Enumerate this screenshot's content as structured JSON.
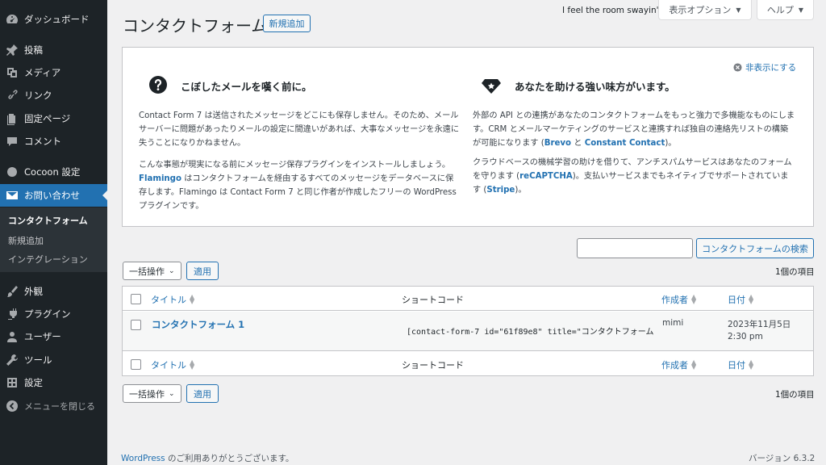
{
  "sidebar": {
    "items": [
      {
        "label": "ダッシュボード",
        "icon": "dashboard-icon"
      },
      {
        "label": "投稿",
        "icon": "pin-icon"
      },
      {
        "label": "メディア",
        "icon": "media-icon"
      },
      {
        "label": "リンク",
        "icon": "link-icon"
      },
      {
        "label": "固定ページ",
        "icon": "page-icon"
      },
      {
        "label": "コメント",
        "icon": "comment-icon"
      },
      {
        "label": "Cocoon 設定",
        "icon": "circle-icon"
      },
      {
        "label": "お問い合わせ",
        "icon": "mail-icon"
      },
      {
        "label": "外観",
        "icon": "brush-icon"
      },
      {
        "label": "プラグイン",
        "icon": "plugin-icon"
      },
      {
        "label": "ユーザー",
        "icon": "user-icon"
      },
      {
        "label": "ツール",
        "icon": "wrench-icon"
      },
      {
        "label": "設定",
        "icon": "settings-icon"
      }
    ],
    "submenu": [
      "コンタクトフォーム",
      "新規追加",
      "インテグレーション"
    ],
    "collapse_label": "メニューを閉じる"
  },
  "header": {
    "title": "コンタクトフォーム",
    "add_new": "新規追加",
    "hello": "I feel the room swayin'",
    "screen_options": "表示オプション",
    "help": "ヘルプ"
  },
  "notice": {
    "dismiss": "非表示にする",
    "left": {
      "heading": "こぼしたメールを嘆く前に。",
      "p1": "Contact Form 7 は送信されたメッセージをどこにも保存しません。そのため、メールサーバーに問題があったりメールの設定に間違いがあれば、大事なメッセージを永遠に失うことになりかねません。",
      "p2_a": "こんな事態が現実になる前にメッセージ保存プラグインをインストールしましょう。",
      "p2_link": "Flamingo",
      "p2_b": " はコンタクトフォームを経由するすべてのメッセージをデータベースに保存します。Flamingo は Contact Form 7 と同じ作者が作成したフリーの WordPress プラグインです。"
    },
    "right": {
      "heading": "あなたを助ける強い味方がいます。",
      "p1_a": "外部の API との連携があなたのコンタクトフォームをもっと強力で多機能なものにします。CRM とメールマーケティングのサービスと連携すれば独自の連絡先リストの構築が可能になります (",
      "p1_link1": "Brevo",
      "p1_mid": " と ",
      "p1_link2": "Constant Contact",
      "p1_b": ")。",
      "p2_a": "クラウドベースの機械学習の助けを借りて、アンチスパムサービスはあなたのフォームを守ります (",
      "p2_link1": "reCAPTCHA",
      "p2_mid": ")。支払いサービスまでもネイティブでサポートされています (",
      "p2_link2": "Stripe",
      "p2_b": ")。"
    }
  },
  "search": {
    "button": "コンタクトフォームの検索",
    "value": ""
  },
  "bulk": {
    "label": "一括操作",
    "apply": "適用"
  },
  "item_count": "1個の項目",
  "table": {
    "columns": {
      "title": "タイトル",
      "shortcode": "ショートコード",
      "author": "作成者",
      "date": "日付"
    },
    "rows": [
      {
        "title": "コンタクトフォーム 1",
        "shortcode": "[contact-form-7 id=\"61f89e8\" title=\"コンタクトフォーム",
        "author": "mimi",
        "date_line1": "2023年11月5日",
        "date_line2": "2:30 pm"
      }
    ]
  },
  "footer": {
    "link": "WordPress",
    "thanks": " のご利用ありがとうございます。",
    "version": "バージョン 6.3.2"
  },
  "colors": {
    "accent": "#2271b1",
    "sidebar_bg": "#1d2327",
    "sidebar_current": "#2271b1"
  }
}
